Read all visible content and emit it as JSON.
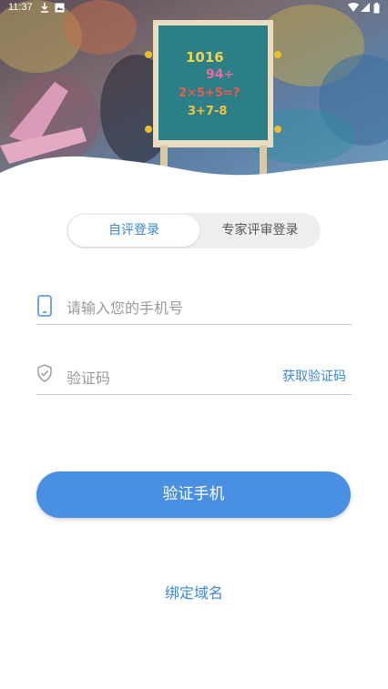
{
  "status_bar": {
    "time": "11:37"
  },
  "hero": {
    "board_lines": [
      "1016",
      "94÷",
      "2×5+5=?",
      "3+7-8"
    ]
  },
  "tabs": [
    {
      "label": "自评登录",
      "active": true
    },
    {
      "label": "专家评审登录",
      "active": false
    }
  ],
  "phone_field": {
    "placeholder": "请输入您的手机号",
    "icon": "phone-icon"
  },
  "code_field": {
    "placeholder": "验证码",
    "icon": "shield-check-icon",
    "action_label": "获取验证码"
  },
  "submit_button": {
    "label": "验证手机"
  },
  "bind_domain_link": {
    "label": "绑定域名"
  },
  "colors": {
    "accent": "#4a90e2",
    "link": "#3b87d9"
  }
}
